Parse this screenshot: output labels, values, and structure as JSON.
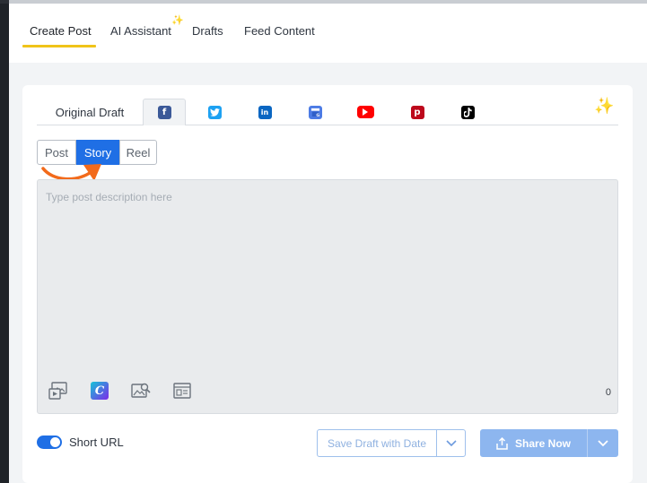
{
  "top_tabs": {
    "create_post": "Create Post",
    "ai_assistant": "AI Assistant",
    "drafts": "Drafts",
    "feed_content": "Feed Content",
    "ai_sparkle_icon": "sparkles-icon"
  },
  "network_tabs": {
    "original_draft": "Original Draft",
    "networks": [
      "facebook-icon",
      "twitter-icon",
      "linkedin-icon",
      "google-business-icon",
      "youtube-icon",
      "pinterest-icon",
      "tiktok-icon"
    ],
    "selected": "facebook",
    "magic_icon": "sparkles-icon"
  },
  "post_type": {
    "options": [
      "Post",
      "Story",
      "Reel"
    ],
    "selected": "Story"
  },
  "editor": {
    "placeholder": "Type post description here",
    "char_count": "0",
    "tools": [
      "media-library-icon",
      "canva-icon",
      "image-search-icon",
      "template-icon"
    ]
  },
  "footer": {
    "short_url_label": "Short URL",
    "short_url_enabled": true,
    "save_draft_label": "Save Draft with Date",
    "share_now_label": "Share Now"
  },
  "colors": {
    "accent_yellow": "#f0c419",
    "primary_blue": "#1f6fe5",
    "annotation_orange": "#f26a1b"
  }
}
